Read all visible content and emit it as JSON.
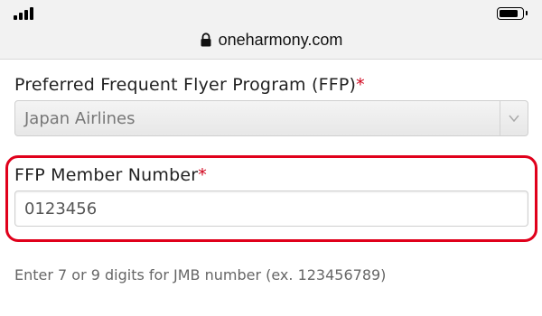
{
  "browser": {
    "url": "oneharmony.com",
    "signal_bars": 4,
    "battery_level": 0.85
  },
  "form": {
    "ffp": {
      "label": "Preferred Frequent Flyer Program (FFP)",
      "required_mark": "*",
      "selected": "Japan Airlines"
    },
    "member_number": {
      "label": "FFP Member Number",
      "required_mark": "*",
      "value": "0123456"
    },
    "hint": "Enter 7 or 9 digits for JMB number (ex. 123456789)"
  },
  "colors": {
    "required": "#d0021b",
    "highlight": "#e0001b"
  }
}
